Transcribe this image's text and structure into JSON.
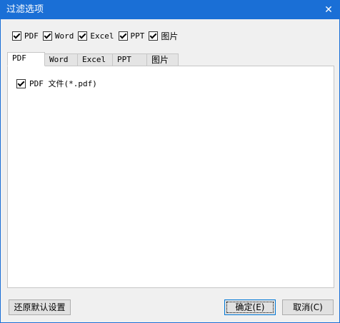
{
  "window": {
    "title": "过滤选项",
    "close_glyph": "✕"
  },
  "filters": [
    {
      "label": "PDF",
      "checked": true
    },
    {
      "label": "Word",
      "checked": true
    },
    {
      "label": "Excel",
      "checked": true
    },
    {
      "label": "PPT",
      "checked": true
    },
    {
      "label": "图片",
      "checked": true
    }
  ],
  "tabs": [
    {
      "label": "PDF",
      "active": true
    },
    {
      "label": "Word",
      "active": false
    },
    {
      "label": "Excel",
      "active": false
    },
    {
      "label": "PPT",
      "active": false
    },
    {
      "label": "图片",
      "active": false
    }
  ],
  "panel": {
    "items": [
      {
        "label": "PDF 文件(*.pdf)",
        "checked": true
      }
    ]
  },
  "buttons": {
    "restore_defaults": "还原默认设置",
    "ok": "确定(E)",
    "cancel": "取消(C)"
  },
  "colors": {
    "titlebar": "#1a6fd6",
    "window_bg": "#f0f0f0"
  }
}
